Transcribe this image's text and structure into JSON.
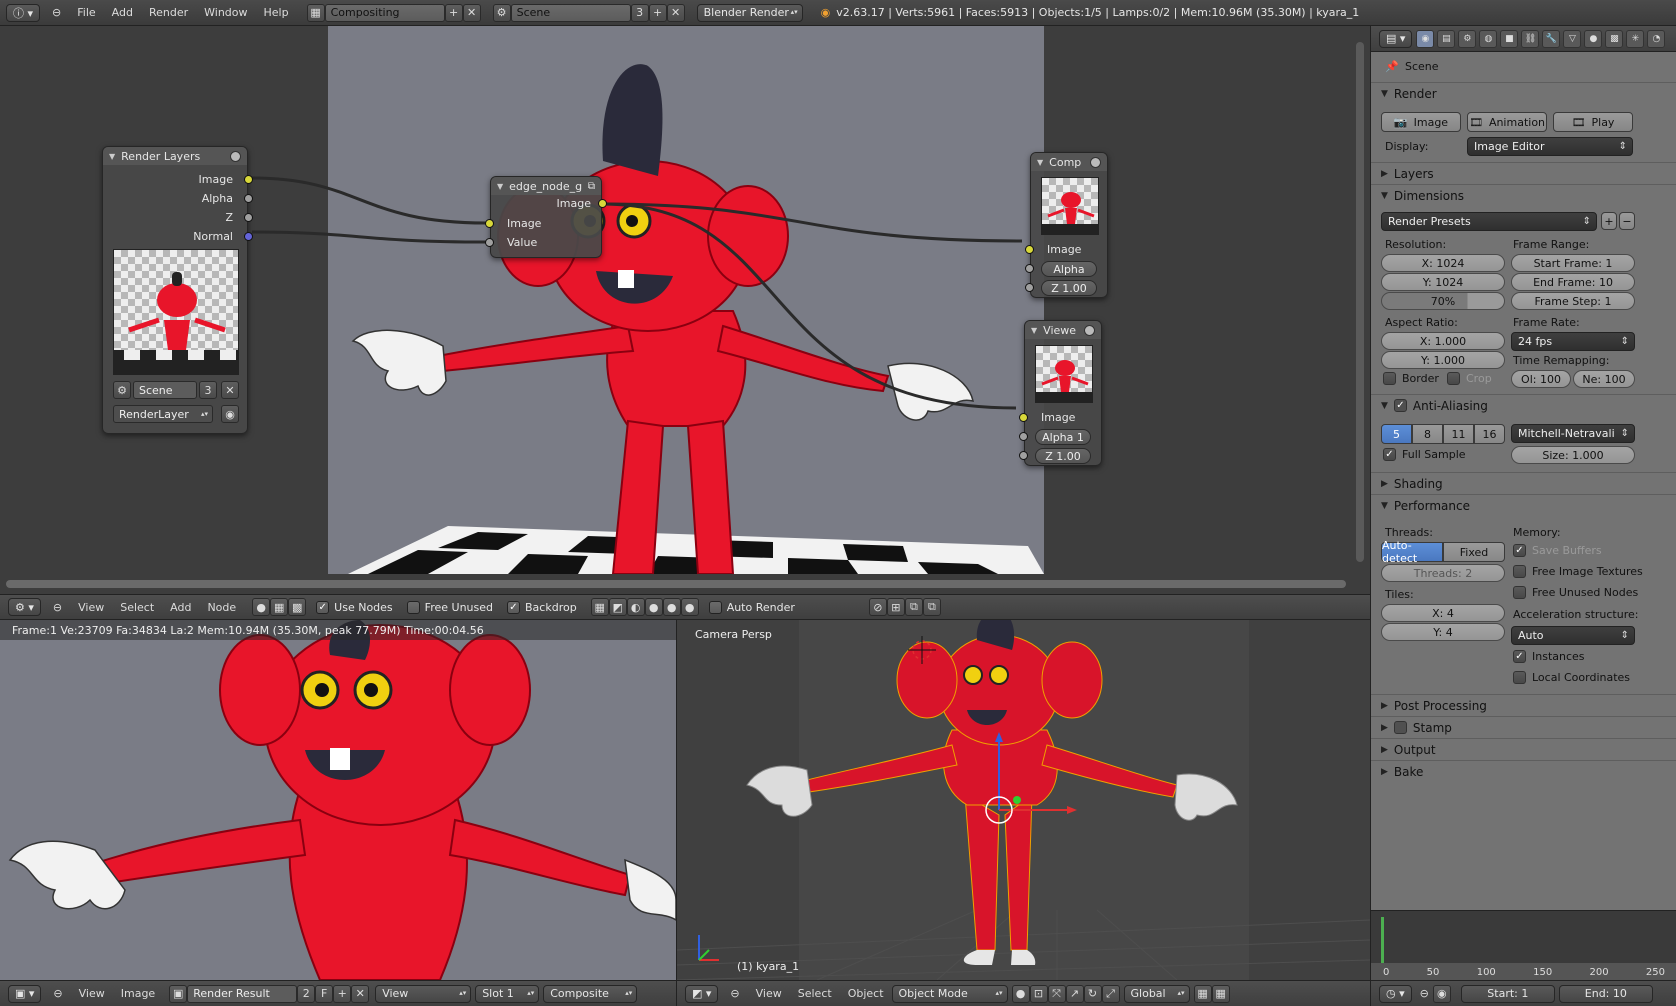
{
  "topbar": {
    "menus": [
      "File",
      "Add",
      "Render",
      "Window",
      "Help"
    ],
    "screen_layout": "Compositing",
    "scene": "Scene",
    "scene_users": "3",
    "engine": "Blender Render",
    "stats": "v2.63.17 | Verts:5961 | Faces:5913 | Objects:1/5 | Lamps:0/2 | Mem:10.96M (35.30M) | kyara_1"
  },
  "nodes": {
    "render_layers": {
      "title": "Render Layers",
      "outputs": [
        "Image",
        "Alpha",
        "Z",
        "Normal"
      ],
      "scene": "Scene",
      "scene_users": "3",
      "layer": "RenderLayer"
    },
    "group": {
      "title": "edge_node_g",
      "output": "Image",
      "inputs": [
        "Image",
        "Value"
      ]
    },
    "composite": {
      "title": "Comp",
      "input": "Image",
      "alpha": "Alpha",
      "z": "Z 1.00"
    },
    "viewer": {
      "title": "Viewe",
      "input": "Image",
      "alpha": "Alpha 1",
      "z": "Z 1.00"
    }
  },
  "node_header": {
    "menus": [
      "View",
      "Select",
      "Add",
      "Node"
    ],
    "use_nodes": "Use Nodes",
    "free_unused": "Free Unused",
    "backdrop": "Backdrop",
    "auto_render": "Auto Render"
  },
  "image_editor": {
    "info": "Frame:1 Ve:23709 Fa:34834 La:2 Mem:10.94M (35.30M, peak 77.79M) Time:00:04.56",
    "menus": [
      "View",
      "Image"
    ],
    "image": "Render Result",
    "users": "2",
    "fake": "F",
    "view": "View",
    "slot": "Slot 1",
    "pass": "Composite"
  },
  "view3d": {
    "label": "Camera Persp",
    "object": "(1) kyara_1",
    "menus": [
      "View",
      "Select",
      "Object"
    ],
    "mode": "Object Mode",
    "orientation": "Global"
  },
  "properties": {
    "scene": "Scene",
    "render": {
      "title": "Render",
      "image_btn": "Image",
      "animation_btn": "Animation",
      "play_btn": "Play",
      "display_label": "Display:",
      "display_value": "Image Editor"
    },
    "layers_title": "Layers",
    "dimensions": {
      "title": "Dimensions",
      "presets": "Render Presets",
      "resolution_label": "Resolution:",
      "res_x": "X: 1024",
      "res_y": "Y: 1024",
      "res_pct": "70%",
      "frame_range_label": "Frame Range:",
      "start": "Start Frame: 1",
      "end": "End Frame: 10",
      "step": "Frame Step: 1",
      "aspect_label": "Aspect Ratio:",
      "asp_x": "X: 1.000",
      "asp_y": "Y: 1.000",
      "frame_rate_label": "Frame Rate:",
      "fps": "24 fps",
      "remap_label": "Time Remapping:",
      "remap_old": "Ol: 100",
      "remap_new": "Ne: 100",
      "border": "Border",
      "crop": "Crop"
    },
    "aa": {
      "title": "Anti-Aliasing",
      "samples": [
        "5",
        "8",
        "11",
        "16"
      ],
      "filter": "Mitchell-Netravali",
      "full_sample": "Full Sample",
      "size": "Size: 1.000"
    },
    "shading_title": "Shading",
    "performance": {
      "title": "Performance",
      "threads_label": "Threads:",
      "auto": "Auto-detect",
      "fixed": "Fixed",
      "threads": "Threads: 2",
      "memory_label": "Memory:",
      "save_buffers": "Save Buffers",
      "free_textures": "Free Image Textures",
      "free_nodes": "Free Unused Nodes",
      "tiles_label": "Tiles:",
      "tiles_x": "X: 4",
      "tiles_y": "Y: 4",
      "accel_label": "Acceleration structure:",
      "accel": "Auto",
      "instances": "Instances",
      "local": "Local Coordinates"
    },
    "post_title": "Post Processing",
    "stamp_title": "Stamp",
    "output_title": "Output",
    "bake_title": "Bake"
  },
  "timeline": {
    "ticks": [
      "0",
      "50",
      "100",
      "150",
      "200",
      "250"
    ],
    "start": "Start: 1",
    "end": "End: 10"
  },
  "colors": {
    "character_red": "#e8152a",
    "selection_blue": "#5d8fd8",
    "socket_yellow": "#d8d83a"
  }
}
